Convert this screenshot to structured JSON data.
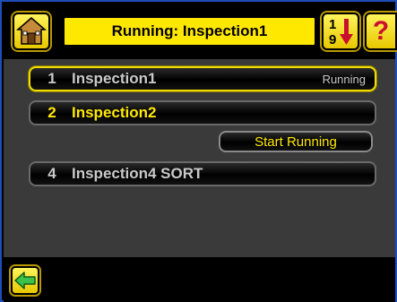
{
  "header": {
    "title": "Running: Inspection1",
    "home_icon": "home-icon",
    "sort_icon": "sort-1-9-icon",
    "sort_digits": [
      "1",
      "9"
    ],
    "help_label": "?"
  },
  "inspections": [
    {
      "number": "1",
      "name": "Inspection1",
      "status": "Running",
      "selected": true
    },
    {
      "number": "2",
      "name": "Inspection2",
      "status": "",
      "selected": false
    },
    {
      "number": "4",
      "name": "Inspection4 SORT",
      "status": "",
      "selected": false
    }
  ],
  "actions": {
    "start_running_label": "Start Running"
  },
  "footer": {
    "back_icon": "back-arrow-icon"
  },
  "colors": {
    "accent_yellow": "#ffe800",
    "border_blue": "#1e4fb8",
    "panel_gray": "#3a3a3a",
    "help_red": "#c8102e",
    "back_arrow_green": "#3cc24a"
  }
}
